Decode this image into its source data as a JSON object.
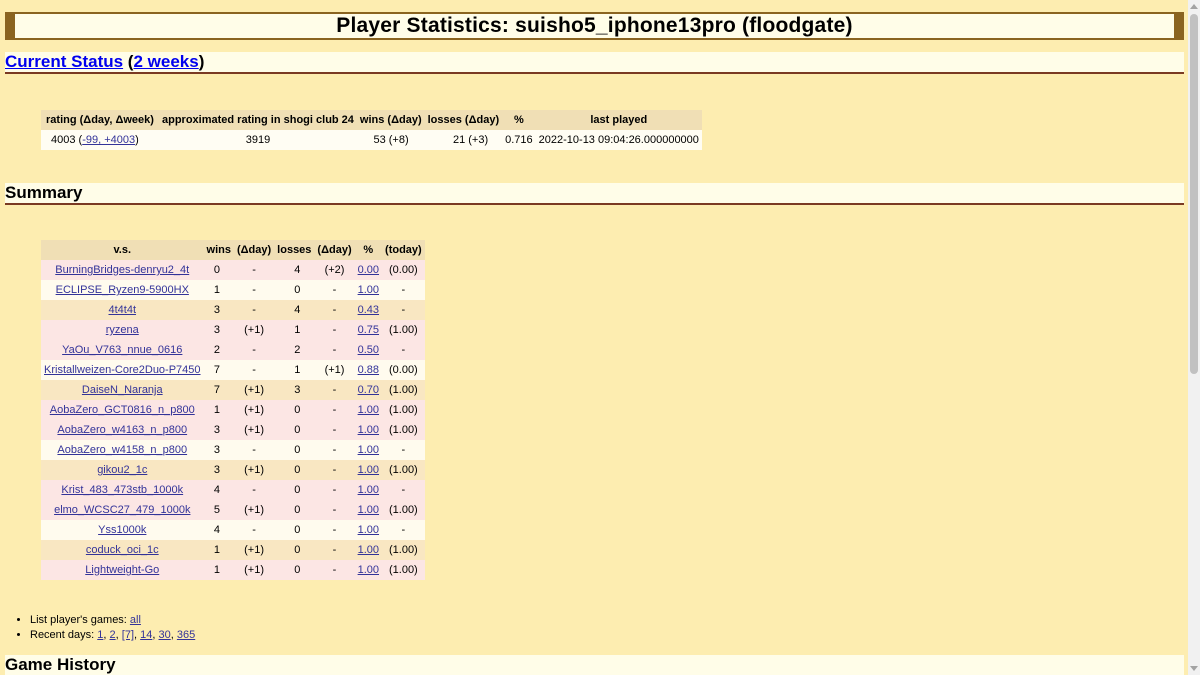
{
  "title": "Player Statistics: suisho5_iphone13pro (floodgate)",
  "current_status": {
    "link_current": "Current Status",
    "paren_open": " (",
    "link_weeks": "2 weeks",
    "paren_close": ")",
    "headers": [
      "rating (Δday, Δweek)",
      "approximated rating in shogi club 24",
      "wins (Δday)",
      "losses (Δday)",
      "%",
      "last played"
    ],
    "row": {
      "rating": "4003",
      "rating_open": " (",
      "rating_delta": "-99, +4003",
      "rating_close": ")",
      "approx": "3919",
      "wins": "53 (+8)",
      "losses": "21 (+3)",
      "pct": "0.716",
      "last_played": "2022-10-13 09:04:26.000000000"
    }
  },
  "summary": {
    "heading": "Summary",
    "headers": [
      "v.s.",
      "wins",
      "(Δday)",
      "losses",
      "(Δday)",
      "%",
      "(today)"
    ],
    "rows": [
      {
        "vs": "BurningBridges-denryu2_4t",
        "wins": "0",
        "wd": "-",
        "losses": "4",
        "ld": "(+2)",
        "pct": "0.00",
        "today": "(0.00)"
      },
      {
        "vs": "ECLIPSE_Ryzen9-5900HX",
        "wins": "1",
        "wd": "-",
        "losses": "0",
        "ld": "-",
        "pct": "1.00",
        "today": "-"
      },
      {
        "vs": "4t4t4t",
        "wins": "3",
        "wd": "-",
        "losses": "4",
        "ld": "-",
        "pct": "0.43",
        "today": "-"
      },
      {
        "vs": "ryzena",
        "wins": "3",
        "wd": "(+1)",
        "losses": "1",
        "ld": "-",
        "pct": "0.75",
        "today": "(1.00)"
      },
      {
        "vs": "YaOu_V763_nnue_0616",
        "wins": "2",
        "wd": "-",
        "losses": "2",
        "ld": "-",
        "pct": "0.50",
        "today": "-"
      },
      {
        "vs": "Kristallweizen-Core2Duo-P7450",
        "wins": "7",
        "wd": "-",
        "losses": "1",
        "ld": "(+1)",
        "pct": "0.88",
        "today": "(0.00)"
      },
      {
        "vs": "DaiseN_Naranja",
        "wins": "7",
        "wd": "(+1)",
        "losses": "3",
        "ld": "-",
        "pct": "0.70",
        "today": "(1.00)"
      },
      {
        "vs": "AobaZero_GCT0816_n_p800",
        "wins": "1",
        "wd": "(+1)",
        "losses": "0",
        "ld": "-",
        "pct": "1.00",
        "today": "(1.00)"
      },
      {
        "vs": "AobaZero_w4163_n_p800",
        "wins": "3",
        "wd": "(+1)",
        "losses": "0",
        "ld": "-",
        "pct": "1.00",
        "today": "(1.00)"
      },
      {
        "vs": "AobaZero_w4158_n_p800",
        "wins": "3",
        "wd": "-",
        "losses": "0",
        "ld": "-",
        "pct": "1.00",
        "today": "-"
      },
      {
        "vs": "gikou2_1c",
        "wins": "3",
        "wd": "(+1)",
        "losses": "0",
        "ld": "-",
        "pct": "1.00",
        "today": "(1.00)"
      },
      {
        "vs": "Krist_483_473stb_1000k",
        "wins": "4",
        "wd": "-",
        "losses": "0",
        "ld": "-",
        "pct": "1.00",
        "today": "-"
      },
      {
        "vs": "elmo_WCSC27_479_1000k",
        "wins": "5",
        "wd": "(+1)",
        "losses": "0",
        "ld": "-",
        "pct": "1.00",
        "today": "(1.00)"
      },
      {
        "vs": "Yss1000k",
        "wins": "4",
        "wd": "-",
        "losses": "0",
        "ld": "-",
        "pct": "1.00",
        "today": "-"
      },
      {
        "vs": "coduck_oci_1c",
        "wins": "1",
        "wd": "(+1)",
        "losses": "0",
        "ld": "-",
        "pct": "1.00",
        "today": "(1.00)"
      },
      {
        "vs": "Lightweight-Go",
        "wins": "1",
        "wd": "(+1)",
        "losses": "0",
        "ld": "-",
        "pct": "1.00",
        "today": "(1.00)"
      }
    ]
  },
  "links": {
    "games_label": "List player's games: ",
    "games_link": "all",
    "recent_label": "Recent days: ",
    "recent_days": [
      "1",
      "2",
      "[7]",
      "14",
      "30",
      "365"
    ],
    "separator": ", "
  },
  "game_history": {
    "heading": "Game History"
  }
}
